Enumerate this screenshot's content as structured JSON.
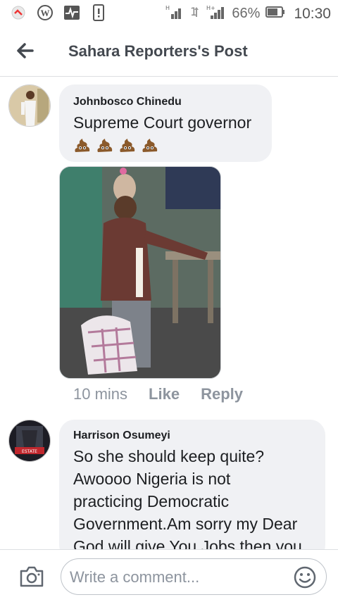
{
  "status_bar": {
    "battery": "66%",
    "time": "10:30",
    "icons": [
      "notification-icon",
      "wordpress-icon",
      "activity-icon",
      "sim-alert-icon",
      "signal-icon",
      "data-icon",
      "signal-h-plus-icon",
      "battery-icon"
    ]
  },
  "header": {
    "title": "Sahara Reporters's Post",
    "back_icon": "arrow-left-icon"
  },
  "comments": [
    {
      "author": "Johnbosco Chinedu",
      "text": "Supreme Court governor",
      "emoji": [
        "pile-of-poo",
        "pile-of-poo",
        "pile-of-poo",
        "pile-of-poo"
      ],
      "time": "10 mins",
      "like_label": "Like",
      "reply_label": "Reply"
    },
    {
      "author": "Harrison Osumeyi",
      "lines": [
        "So she should keep quite?",
        "Awoooo Nigeria is not",
        "practicing Democratic",
        "Government.Am sorry my Dear",
        "God will give You Jobs then you"
      ]
    }
  ],
  "composer": {
    "placeholder": "Write a comment...",
    "camera_icon": "camera-icon",
    "emoji_icon": "smiley-icon"
  },
  "colors": {
    "bubble": "#f0f1f4",
    "muted": "#8d949e",
    "text": "#1c1e21"
  }
}
